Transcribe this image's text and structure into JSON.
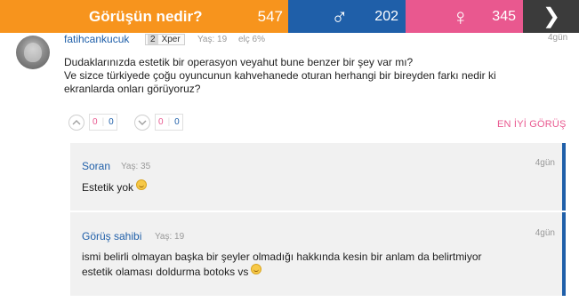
{
  "topbar": {
    "question": "Görüşün nedir?",
    "question_count": "547",
    "male_symbol": "♂",
    "male_count": "202",
    "female_symbol": "♀",
    "female_count": "345",
    "next_symbol": "❯",
    "colors": {
      "orange": "#f7941d",
      "blue": "#1f5fa9",
      "pink": "#e9588f",
      "dark": "#3b3b3b"
    }
  },
  "post": {
    "username": "fatihcankucuk",
    "level": "2",
    "level_label": "Xper",
    "age": "Yaş: 19",
    "percent": "elç 6%",
    "time": "4gün",
    "text_lines": [
      "Dudaklarınızda estetik bir operasyon veyahut bune benzer bir şey var mı?",
      "Ve sizce türkiyede çoğu oyuncunun kahvehanede oturan herhangi bir bireyden farkı nedir ki",
      "ekranlarda onları görüyoruz?"
    ],
    "upvote": {
      "icon": "chevron-up-icon",
      "red": "0",
      "blue": "0"
    },
    "downvote": {
      "icon": "chevron-down-icon",
      "red": "0",
      "blue": "0"
    },
    "best_label": "EN İYİ GÖRÜŞ"
  },
  "replies": [
    {
      "name": "Soran",
      "age": "Yaş: 35",
      "time": "4gün",
      "text": "Estetik yok"
    },
    {
      "name": "Görüş sahibi",
      "age": "Yaş: 19",
      "time": "4gün",
      "text_lines": [
        "ismi belirli olmayan başka bir şeyler olmadığı hakkında kesin bir anlam da belirtmiyor",
        "estetik olaması doldurma botoks vs"
      ]
    }
  ]
}
